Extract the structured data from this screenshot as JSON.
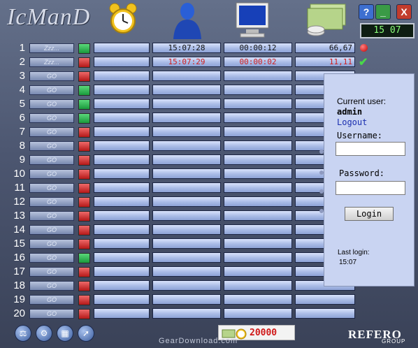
{
  "app": {
    "logo": "IcManD",
    "clock": "15 07",
    "window_buttons": {
      "help": "?",
      "minimize": "_",
      "close": "X"
    }
  },
  "header_icons": [
    "alarm-clock-icon",
    "user-icon",
    "monitor-icon",
    "money-icon"
  ],
  "rows": [
    {
      "n": "1",
      "go": "Zzz...",
      "status": "green",
      "start": "15:07:28",
      "elapsed": "00:00:12",
      "amount": "66,67",
      "row_status": "red-dot"
    },
    {
      "n": "2",
      "go": "Zzz...",
      "status": "red",
      "start": "15:07:29",
      "elapsed": "00:00:02",
      "amount": "11,11",
      "row_status": "check",
      "red_text": true
    },
    {
      "n": "3",
      "go": "GO",
      "status": "red"
    },
    {
      "n": "4",
      "go": "GO",
      "status": "green"
    },
    {
      "n": "5",
      "go": "GO",
      "status": "green"
    },
    {
      "n": "6",
      "go": "GO",
      "status": "green"
    },
    {
      "n": "7",
      "go": "GO",
      "status": "red"
    },
    {
      "n": "8",
      "go": "GO",
      "status": "red"
    },
    {
      "n": "9",
      "go": "GO",
      "status": "red"
    },
    {
      "n": "10",
      "go": "GO",
      "status": "red"
    },
    {
      "n": "11",
      "go": "GO",
      "status": "red"
    },
    {
      "n": "12",
      "go": "GO",
      "status": "red"
    },
    {
      "n": "13",
      "go": "GO",
      "status": "red"
    },
    {
      "n": "14",
      "go": "GO",
      "status": "red"
    },
    {
      "n": "15",
      "go": "GO",
      "status": "red"
    },
    {
      "n": "16",
      "go": "GO",
      "status": "green"
    },
    {
      "n": "17",
      "go": "GO",
      "status": "red"
    },
    {
      "n": "18",
      "go": "GO",
      "status": "red"
    },
    {
      "n": "19",
      "go": "GO",
      "status": "red"
    },
    {
      "n": "20",
      "go": "GO",
      "status": "red"
    }
  ],
  "login_panel": {
    "current_user_label": "Current user:",
    "current_user": "admin",
    "logout": "Logout",
    "username_label": "Username:",
    "username_value": "",
    "password_label": "Password:",
    "password_value": "",
    "login_button": "Login",
    "last_login_label": "Last login:",
    "last_login_value": "15:07"
  },
  "footer": {
    "icons": [
      "scales-icon",
      "network-icon",
      "settings-icon",
      "speedometer-icon"
    ],
    "credits_value": "20000",
    "brand": "REFERO",
    "brand_sub": "GROUP",
    "watermark": "GearDownload.com"
  },
  "colors": {
    "red_status": "#c41a1a",
    "green_status": "#1fa045",
    "accent_cell": "#a9bbe6"
  }
}
